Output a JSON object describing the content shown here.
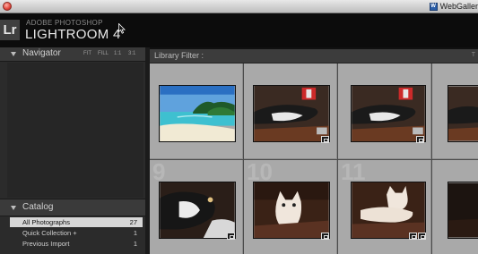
{
  "window": {
    "app_name": "WebGaller"
  },
  "identity_plate": {
    "logo_text": "Lr",
    "product_line": "ADOBE PHOTOSHOP",
    "product_name": "LIGHTROOM 4"
  },
  "navigator": {
    "title": "Navigator",
    "zoom_options": [
      "FIT",
      "FILL",
      "1:1",
      "3:1"
    ]
  },
  "catalog": {
    "title": "Catalog",
    "items": [
      {
        "label": "All Photographs",
        "count": "27",
        "selected": true
      },
      {
        "label": "Quick Collection  +",
        "count": "1",
        "selected": false
      },
      {
        "label": "Previous Import",
        "count": "1",
        "selected": false
      }
    ]
  },
  "filter_bar": {
    "label": "Library Filter :",
    "trailing": "T"
  },
  "grid": {
    "cell_numbers": [
      "",
      "",
      "",
      "",
      "9",
      "10",
      "11",
      ""
    ],
    "thumbnails": [
      {
        "name": "beach-photo",
        "badge": false
      },
      {
        "name": "cat-sleeping-photo",
        "badge": true
      },
      {
        "name": "cat-sleeping-photo",
        "badge": true
      },
      {
        "name": "cat-partial-photo",
        "badge": false
      },
      {
        "name": "cat-lying-photo",
        "badge": true
      },
      {
        "name": "kitten-sitting-photo",
        "badge": true
      },
      {
        "name": "kitten-lying-photo",
        "badge": true
      },
      {
        "name": "partial-photo",
        "badge": false
      }
    ]
  },
  "colors": {
    "panel_bg": "#2b2b2b",
    "grid_cell_bg": "#a9a9a9",
    "selected_row_bg": "#d7d7d7"
  }
}
